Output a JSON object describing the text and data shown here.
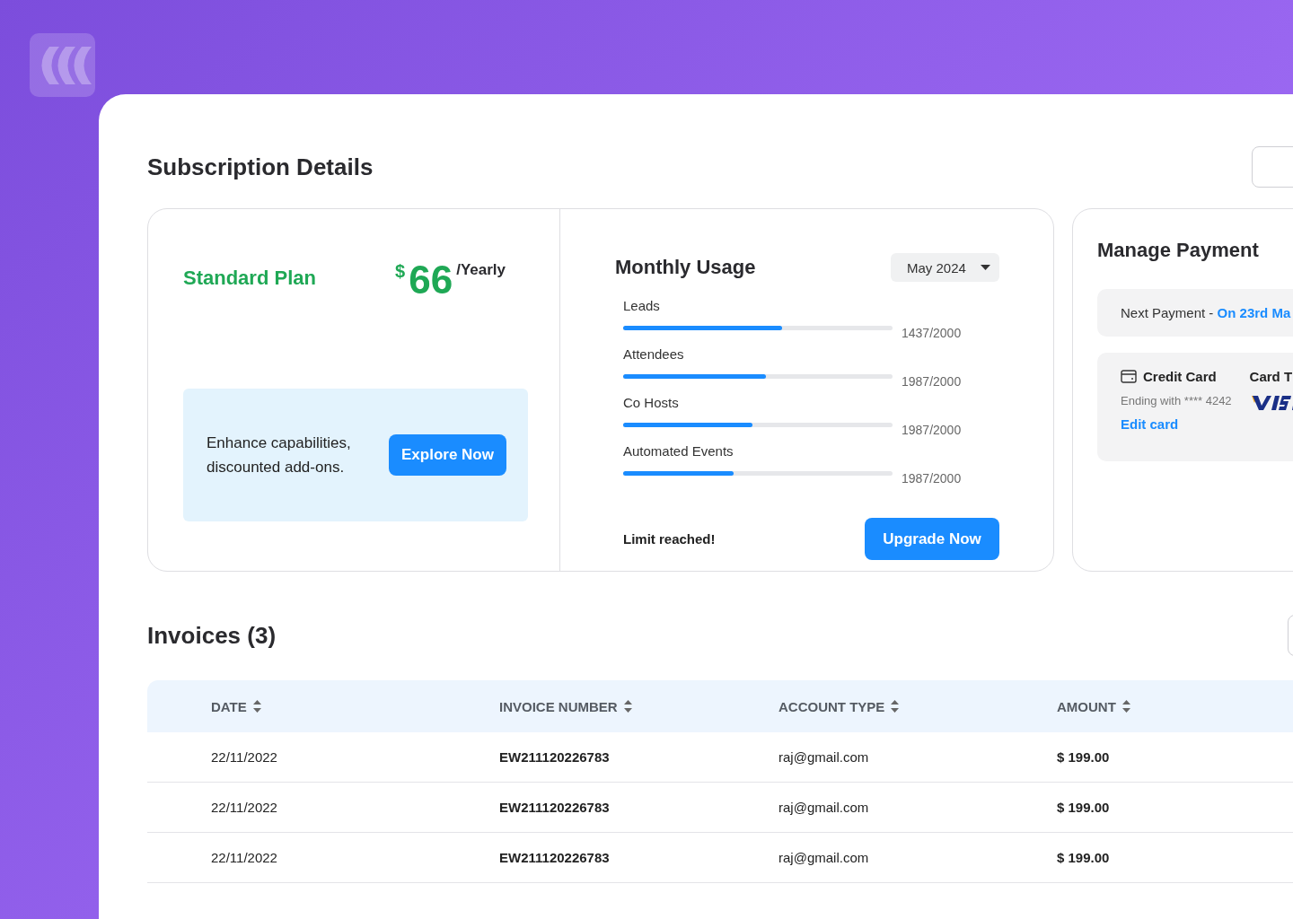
{
  "page": {
    "title": "Subscription Details"
  },
  "plan": {
    "name": "Standard Plan",
    "currency": "$",
    "price": "66",
    "period": "/Yearly",
    "promo_text": "Enhance capabilities, discounted add-ons.",
    "promo_button": "Explore Now"
  },
  "usage": {
    "title": "Monthly Usage",
    "month": "May 2024",
    "meters": [
      {
        "label": "Leads",
        "level": 0.59,
        "reading": "1437/2000"
      },
      {
        "label": "Attendees",
        "level": 0.53,
        "reading": "1987/2000"
      },
      {
        "label": "Co Hosts",
        "level": 0.48,
        "reading": "1987/2000"
      },
      {
        "label": "Automated Events",
        "level": 0.41,
        "reading": "1987/2000"
      }
    ],
    "status": "Limit reached!",
    "button": "Upgrade Now"
  },
  "payment": {
    "title": "Manage Payment",
    "next_label": "Next Payment - ",
    "next_date": "On 23rd Ma",
    "method": "Credit Card",
    "ending": "Ending with **** 4242",
    "edit": "Edit card",
    "card_type_label": "Card T"
  },
  "invoices": {
    "title": "Invoices (3)",
    "columns": [
      "DATE",
      "INVOICE NUMBER",
      "ACCOUNT TYPE",
      "AMOUNT"
    ],
    "rows": [
      [
        "22/11/2022",
        "EW211120226783",
        "raj@gmail.com",
        "$ 199.00"
      ],
      [
        "22/11/2022",
        "EW211120226783",
        "raj@gmail.com",
        "$ 199.00"
      ],
      [
        "22/11/2022",
        "EW211120226783",
        "raj@gmail.com",
        "$ 199.00"
      ]
    ]
  }
}
